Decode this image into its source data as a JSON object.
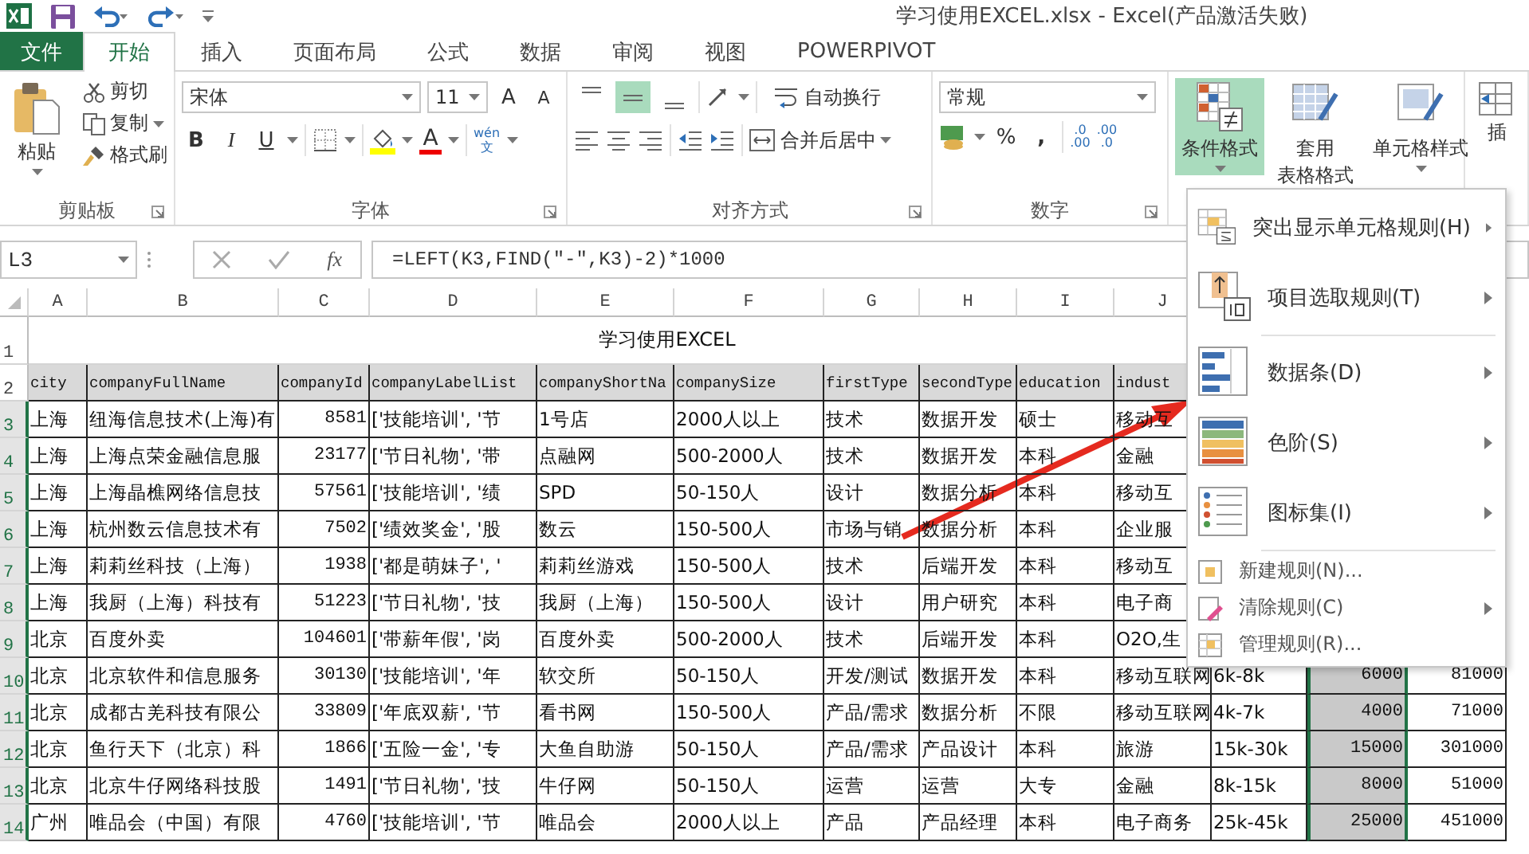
{
  "title_bar": {
    "title": "学习使用EXCEL.xlsx - Excel(产品激活失败)"
  },
  "tabs": [
    {
      "label": "文件",
      "kind": "file",
      "selected": false
    },
    {
      "label": "开始",
      "kind": "tab",
      "selected": true
    },
    {
      "label": "插入",
      "kind": "tab",
      "selected": false
    },
    {
      "label": "页面布局",
      "kind": "tab",
      "selected": false
    },
    {
      "label": "公式",
      "kind": "tab",
      "selected": false
    },
    {
      "label": "数据",
      "kind": "tab",
      "selected": false
    },
    {
      "label": "审阅",
      "kind": "tab",
      "selected": false
    },
    {
      "label": "视图",
      "kind": "tab",
      "selected": false
    },
    {
      "label": "POWERPIVOT",
      "kind": "tab",
      "selected": false
    }
  ],
  "ribbon": {
    "clipboard": {
      "paste": "粘贴",
      "cut": "剪切",
      "copy": "复制",
      "format_painter": "格式刷",
      "label": "剪贴板"
    },
    "font": {
      "name": "宋体",
      "size": "11",
      "grow": "A",
      "shrink": "A",
      "bold": "B",
      "italic": "I",
      "underline": "U",
      "font_color_label": "A",
      "phonetic_top": "wén",
      "phonetic_bottom": "文",
      "label": "字体"
    },
    "alignment": {
      "vertical": [
        {
          "selected": false
        },
        {
          "selected": true
        },
        {
          "selected": false
        }
      ],
      "wrap": "自动换行",
      "merge": "合并后居中",
      "label": "对齐方式"
    },
    "number": {
      "format": "常规",
      "percent": "%",
      "comma": ",",
      "increase_decimal": {
        "top": ".0",
        "bottom": ".00"
      },
      "decrease_decimal": {
        "top": ".00",
        "bottom": ".0"
      },
      "label": "数字"
    },
    "styles": {
      "conditional": {
        "label": "条件格式",
        "active": true
      },
      "table_format": [
        "套用",
        "表格格式"
      ],
      "cell_styles": "单元格样式"
    },
    "cells": {
      "insert": "插"
    }
  },
  "formula_bar": {
    "name_box": "L3",
    "fx": "fx",
    "formula": "=LEFT(K3,FIND(\"-\",K3)-2)*1000"
  },
  "sheet": {
    "columns": [
      {
        "label": "A",
        "selected": false,
        "numeric": false
      },
      {
        "label": "B",
        "selected": false,
        "numeric": false
      },
      {
        "label": "C",
        "selected": false,
        "numeric": true
      },
      {
        "label": "D",
        "selected": false,
        "numeric": false
      },
      {
        "label": "E",
        "selected": false,
        "numeric": false
      },
      {
        "label": "F",
        "selected": false,
        "numeric": false
      },
      {
        "label": "G",
        "selected": false,
        "numeric": false
      },
      {
        "label": "H",
        "selected": false,
        "numeric": false
      },
      {
        "label": "I",
        "selected": false,
        "numeric": false
      },
      {
        "label": "J",
        "selected": false,
        "numeric": false
      },
      {
        "selected": false,
        "numeric": false
      },
      {
        "selected": true,
        "numeric": true
      },
      {
        "selected": false,
        "numeric": true
      }
    ],
    "title_row": {
      "num": "1",
      "selected": false,
      "text": "学习使用EXCEL"
    },
    "header_row": {
      "num": "2",
      "selected": false,
      "cells": [
        "city",
        "companyFullName",
        "companyId",
        "companyLabelList",
        "companyShortNa",
        "companySize",
        "firstType",
        "secondType",
        "education",
        "indust"
      ]
    },
    "rows": [
      {
        "num": "3",
        "selected": true,
        "cells": [
          "上海",
          "纽海信息技术(上海)有",
          "8581",
          "['技能培训', '节",
          "1号店",
          "2000人以上",
          "技术",
          "数据开发",
          "硕士",
          "移动互"
        ]
      },
      {
        "num": "4",
        "selected": true,
        "cells": [
          "上海",
          "上海点荣金融信息服",
          "23177",
          "['节日礼物', '带",
          "点融网",
          "500-2000人",
          "技术",
          "数据开发",
          "本科",
          "金融"
        ]
      },
      {
        "num": "5",
        "selected": true,
        "cells": [
          "上海",
          "上海晶樵网络信息技",
          "57561",
          "['技能培训', '绩",
          "SPD",
          "50-150人",
          "设计",
          "数据分析",
          "本科",
          "移动互"
        ]
      },
      {
        "num": "6",
        "selected": true,
        "cells": [
          "上海",
          "杭州数云信息技术有",
          "7502",
          "['绩效奖金', '股",
          "数云",
          "150-500人",
          "市场与销",
          "数据分析",
          "本科",
          "企业服"
        ]
      },
      {
        "num": "7",
        "selected": true,
        "cells": [
          "上海",
          "莉莉丝科技（上海）",
          "1938",
          "['都是萌妹子', '",
          "莉莉丝游戏",
          "150-500人",
          "技术",
          "后端开发",
          "本科",
          "移动互"
        ]
      },
      {
        "num": "8",
        "selected": true,
        "cells": [
          "上海",
          "我厨（上海）科技有",
          "51223",
          "['节日礼物', '技",
          "我厨（上海）",
          "150-500人",
          "设计",
          "用户研究",
          "本科",
          "电子商"
        ]
      },
      {
        "num": "9",
        "selected": true,
        "cells": [
          "北京",
          "百度外卖",
          "104601",
          "['带薪年假', '岗",
          "百度外卖",
          "500-2000人",
          "技术",
          "后端开发",
          "本科",
          "O2O,生"
        ]
      },
      {
        "num": "10",
        "selected": true,
        "cells": [
          "北京",
          "北京软件和信息服务",
          "30130",
          "['技能培训', '年",
          "软交所",
          "50-150人",
          "开发/测试",
          "数据开发",
          "本科",
          "移动互联网",
          "6k-8k",
          "6000",
          "81000"
        ]
      },
      {
        "num": "11",
        "selected": true,
        "cells": [
          "北京",
          "成都古羌科技有限公",
          "33809",
          "['年底双薪', '节",
          "看书网",
          "150-500人",
          "产品/需求",
          "数据分析",
          "不限",
          "移动互联网",
          "4k-7k",
          "4000",
          "71000"
        ]
      },
      {
        "num": "12",
        "selected": true,
        "cells": [
          "北京",
          "鱼行天下（北京）科",
          "1866",
          "['五险一金', '专",
          "大鱼自助游",
          "50-150人",
          "产品/需求",
          "产品设计",
          "本科",
          "旅游",
          "15k-30k",
          "15000",
          "301000"
        ]
      },
      {
        "num": "13",
        "selected": true,
        "cells": [
          "北京",
          "北京牛仔网络科技股",
          "1491",
          "['节日礼物', '技",
          "牛仔网",
          "50-150人",
          "运营",
          "运营",
          "大专",
          "金融",
          "8k-15k",
          "8000",
          "51000"
        ]
      },
      {
        "num": "14",
        "selected": true,
        "cells": [
          "广州",
          "唯品会（中国）有限",
          "4760",
          "['技能培训', '节",
          "唯品会",
          "2000人以上",
          "产品",
          "产品经理",
          "本科",
          "电子商务",
          "25k-45k",
          "25000",
          "451000"
        ]
      }
    ]
  },
  "menu": {
    "items": [
      {
        "label": "突出显示单元格规则(H)",
        "kind": "large",
        "submenu": true
      },
      {
        "label": "项目选取规则(T)",
        "kind": "large",
        "submenu": true
      },
      {
        "label": "数据条(D)",
        "kind": "large",
        "submenu": true
      },
      {
        "label": "色阶(S)",
        "kind": "large",
        "submenu": true
      },
      {
        "label": "图标集(I)",
        "kind": "large",
        "submenu": true
      },
      {
        "label": "新建规则(N)...",
        "kind": "small",
        "submenu": false
      },
      {
        "label": "清除规则(C)",
        "kind": "small",
        "submenu": true
      },
      {
        "label": "管理规则(R)...",
        "kind": "small",
        "submenu": false
      }
    ]
  },
  "annotation": {
    "kind": "arrow"
  }
}
